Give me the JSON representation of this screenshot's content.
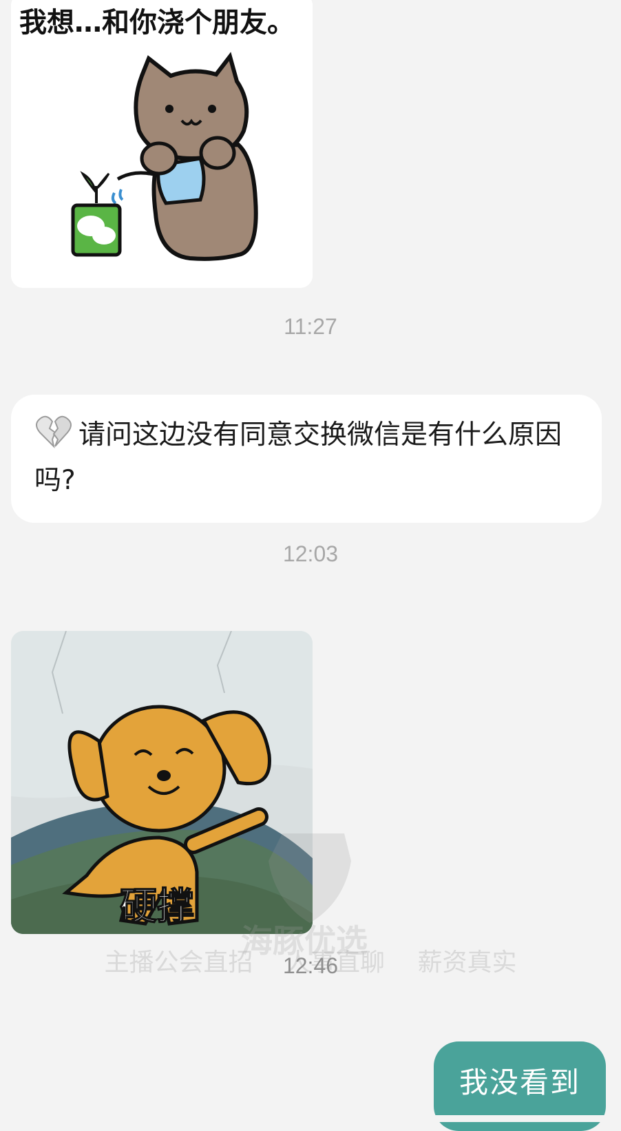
{
  "messages": {
    "sticker_1": {
      "caption": "我想…和你浇个朋友。"
    },
    "time_1": "11:27",
    "text_1": {
      "emoji": "broken-heart-icon",
      "text": "请问这边没有同意交换微信是有什么原因吗?"
    },
    "time_2": "12:03",
    "sticker_2": {
      "caption": "硬撑"
    },
    "time_3": "12:46",
    "sent_1": {
      "text": "我没看到"
    }
  },
  "watermark": {
    "brand": "海豚优选",
    "items": [
      "主播公会直招",
      "人事直聊",
      "薪资真实"
    ]
  },
  "colors": {
    "background": "#f3f3f3",
    "sent_bubble": "#4aa39a",
    "bear": "#a08876",
    "dog": "#e3a33a"
  }
}
